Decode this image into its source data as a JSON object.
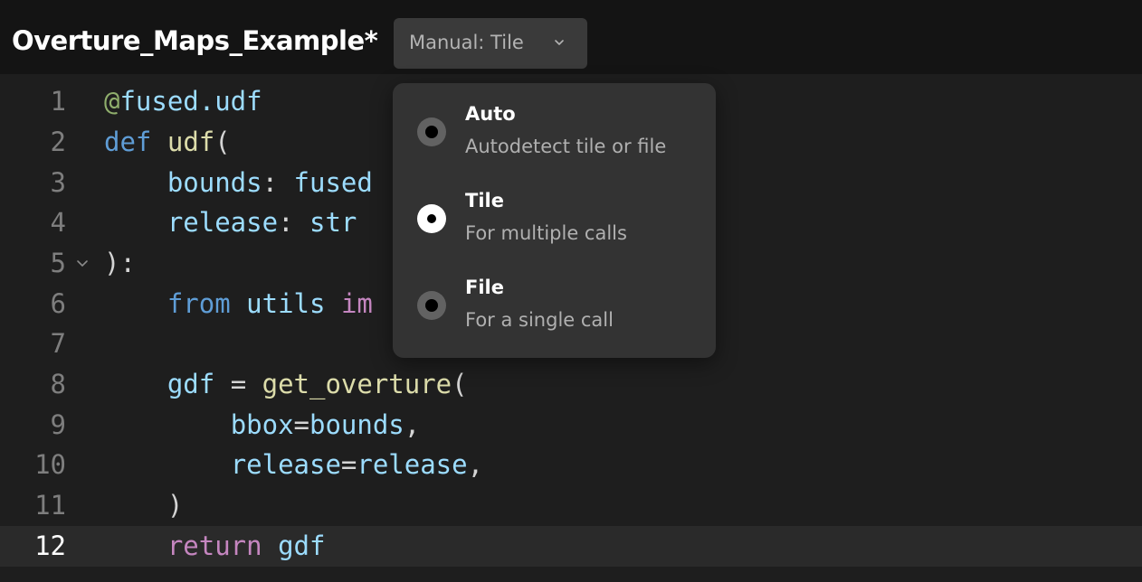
{
  "header": {
    "file_title": "Overture_Maps_Example*",
    "mode_select": {
      "value": "Manual: Tile",
      "icon": "chevron-down-icon"
    }
  },
  "editor": {
    "active_line": 12,
    "lines": [
      {
        "number": "1",
        "tokens": [
          {
            "t": "@",
            "c": "deco"
          },
          {
            "t": "fused.udf",
            "c": "var"
          }
        ]
      },
      {
        "number": "2",
        "tokens": [
          {
            "t": "def",
            "c": "kw"
          },
          {
            "t": " ",
            "c": "plain"
          },
          {
            "t": "udf",
            "c": "fn"
          },
          {
            "t": "(",
            "c": "plain"
          }
        ]
      },
      {
        "number": "3",
        "tokens": [
          {
            "t": "    ",
            "c": "plain"
          },
          {
            "t": "bounds",
            "c": "var"
          },
          {
            "t": ": ",
            "c": "plain"
          },
          {
            "t": "fused",
            "c": "var"
          }
        ]
      },
      {
        "number": "4",
        "tokens": [
          {
            "t": "    ",
            "c": "plain"
          },
          {
            "t": "release",
            "c": "var"
          },
          {
            "t": ": ",
            "c": "plain"
          },
          {
            "t": "str",
            "c": "var"
          }
        ]
      },
      {
        "number": "5",
        "tokens": [
          {
            "t": "):",
            "c": "plain"
          }
        ],
        "fold": true
      },
      {
        "number": "6",
        "tokens": [
          {
            "t": "    ",
            "c": "plain"
          },
          {
            "t": "from",
            "c": "kw"
          },
          {
            "t": " ",
            "c": "plain"
          },
          {
            "t": "utils",
            "c": "var"
          },
          {
            "t": " ",
            "c": "plain"
          },
          {
            "t": "im",
            "c": "imp"
          }
        ]
      },
      {
        "number": "7",
        "tokens": []
      },
      {
        "number": "8",
        "tokens": [
          {
            "t": "    ",
            "c": "plain"
          },
          {
            "t": "gdf",
            "c": "var"
          },
          {
            "t": " = ",
            "c": "plain"
          },
          {
            "t": "get_overture",
            "c": "fn"
          },
          {
            "t": "(",
            "c": "plain"
          }
        ]
      },
      {
        "number": "9",
        "tokens": [
          {
            "t": "        ",
            "c": "plain"
          },
          {
            "t": "bbox",
            "c": "var"
          },
          {
            "t": "=",
            "c": "plain"
          },
          {
            "t": "bounds",
            "c": "var"
          },
          {
            "t": ",",
            "c": "plain"
          }
        ]
      },
      {
        "number": "10",
        "tokens": [
          {
            "t": "        ",
            "c": "plain"
          },
          {
            "t": "release",
            "c": "var"
          },
          {
            "t": "=",
            "c": "plain"
          },
          {
            "t": "release",
            "c": "var"
          },
          {
            "t": ",",
            "c": "plain"
          }
        ]
      },
      {
        "number": "11",
        "tokens": [
          {
            "t": "    ",
            "c": "plain"
          },
          {
            "t": ")",
            "c": "plain"
          }
        ]
      },
      {
        "number": "12",
        "tokens": [
          {
            "t": "    ",
            "c": "plain"
          },
          {
            "t": "return",
            "c": "imp"
          },
          {
            "t": " ",
            "c": "plain"
          },
          {
            "t": "gdf",
            "c": "var"
          }
        ]
      }
    ]
  },
  "dropdown": {
    "options": [
      {
        "title": "Auto",
        "description": "Autodetect tile or file",
        "selected": false
      },
      {
        "title": "Tile",
        "description": "For multiple calls",
        "selected": true
      },
      {
        "title": "File",
        "description": "For a single call",
        "selected": false
      }
    ]
  },
  "colors": {
    "decorator": "#8fae6c",
    "keyword": "#5f9dd6",
    "function": "#dcdcaa",
    "variable": "#9cdcfe",
    "control": "#c586c0",
    "background": "#1e1e1e"
  }
}
